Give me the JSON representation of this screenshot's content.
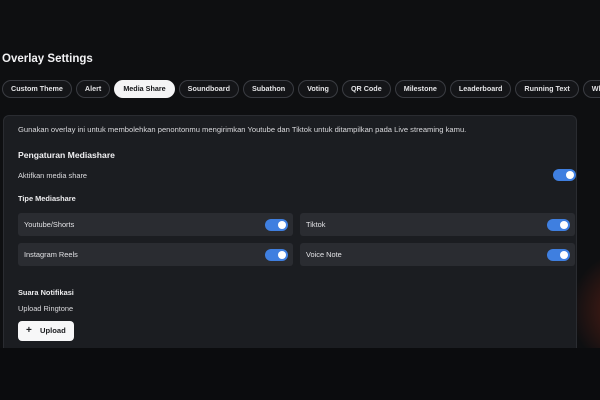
{
  "page": {
    "title": "Overlay Settings"
  },
  "tabs": [
    {
      "label": "Custom Theme"
    },
    {
      "label": "Alert"
    },
    {
      "label": "Media Share",
      "active": true
    },
    {
      "label": "Soundboard"
    },
    {
      "label": "Subathon"
    },
    {
      "label": "Voting"
    },
    {
      "label": "QR Code"
    },
    {
      "label": "Milestone"
    },
    {
      "label": "Leaderboard"
    },
    {
      "label": "Running Text"
    },
    {
      "label": "Wheel"
    }
  ],
  "panel": {
    "description": "Gunakan overlay ini untuk membolehkan penontonmu mengirimkan Youtube dan Tiktok untuk ditampilkan pada Live streaming kamu.",
    "settings_heading": "Pengaturan Mediashare",
    "enable_label": "Aktifkan media share",
    "enable_on": true,
    "type_heading": "Tipe Mediashare",
    "types": [
      {
        "label": "Youtube/Shorts",
        "on": true
      },
      {
        "label": "Tiktok",
        "on": true
      },
      {
        "label": "Instagram Reels",
        "on": true
      },
      {
        "label": "Voice Note",
        "on": true
      }
    ],
    "notif_heading": "Suara Notifikasi",
    "ringtone_label": "Upload Ringtone",
    "upload_label": "Upload",
    "upload_icon": "plus-icon"
  },
  "colors": {
    "background": "#0e0f11",
    "panel": "#1b1d21",
    "card": "#2a2c31",
    "toggle_on": "#3f7fe0",
    "active_tab": "#f4f4f5"
  }
}
